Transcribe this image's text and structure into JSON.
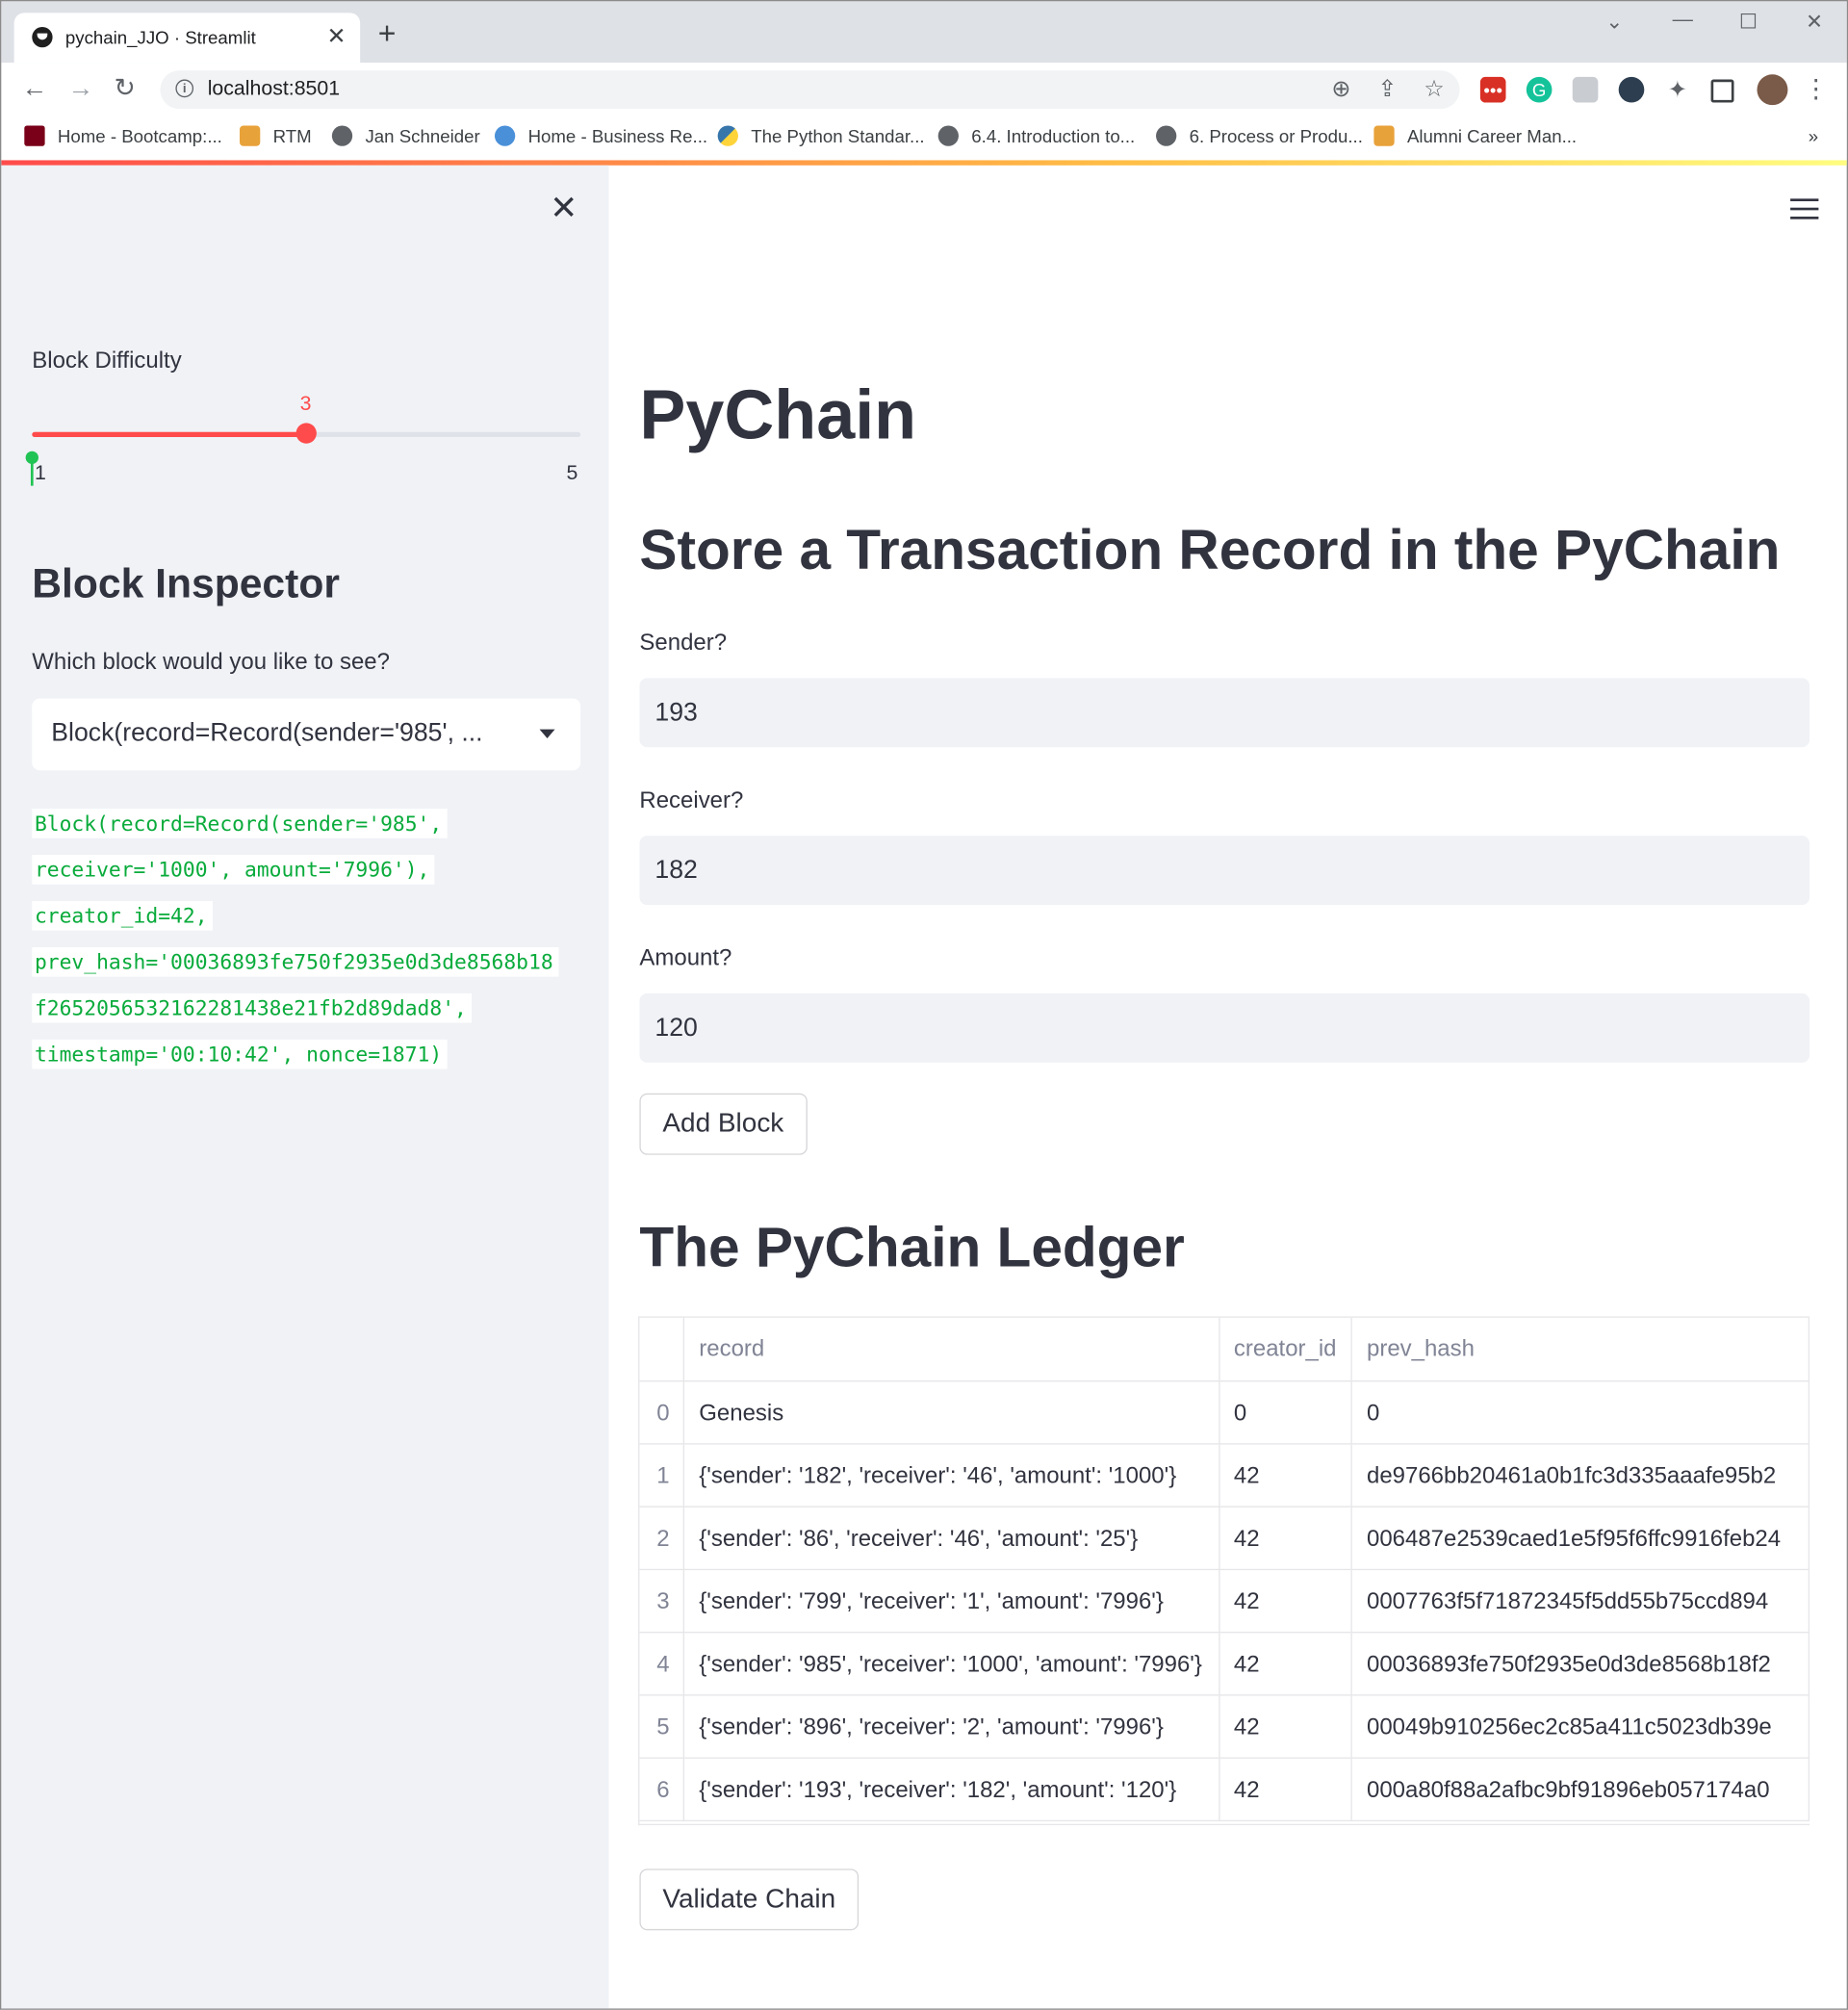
{
  "browser": {
    "tab_title": "pychain_JJO · Streamlit",
    "url": "localhost:8501",
    "bookmarks": [
      "Home - Bootcamp:...",
      "RTM",
      "Jan Schneider",
      "Home - Business Re...",
      "The Python Standar...",
      "6.4. Introduction to...",
      "6. Process or Produ...",
      "Alumni Career Man..."
    ]
  },
  "sidebar": {
    "slider_label": "Block Difficulty",
    "slider_value": "3",
    "slider_min": "1",
    "slider_max": "5",
    "inspector_title": "Block Inspector",
    "select_question": "Which block would you like to see?",
    "select_value": "Block(record=Record(sender='985', ...",
    "code_lines": [
      "Block(record=Record(sender='985',",
      "receiver='1000', amount='7996'),",
      "creator_id=42,",
      "prev_hash='00036893fe750f2935e0d3de8568b18",
      "f2652056532162281438e21fb2d89dad8',",
      "timestamp='00:10:42', nonce=1871)"
    ]
  },
  "main": {
    "title": "PyChain",
    "subtitle": "Store a Transaction Record in the PyChain",
    "sender_label": "Sender?",
    "sender_value": "193",
    "receiver_label": "Receiver?",
    "receiver_value": "182",
    "amount_label": "Amount?",
    "amount_value": "120",
    "add_block_label": "Add Block",
    "ledger_title": "The PyChain Ledger",
    "validate_label": "Validate Chain",
    "ledger": {
      "columns": [
        "",
        "record",
        "creator_id",
        "prev_hash"
      ],
      "rows": [
        [
          "0",
          "Genesis",
          "0",
          "0"
        ],
        [
          "1",
          "{'sender': '182', 'receiver': '46', 'amount': '1000'}",
          "42",
          "de9766bb20461a0b1fc3d335aaafe95b2"
        ],
        [
          "2",
          "{'sender': '86', 'receiver': '46', 'amount': '25'}",
          "42",
          "006487e2539caed1e5f95f6ffc9916feb24"
        ],
        [
          "3",
          "{'sender': '799', 'receiver': '1', 'amount': '7996'}",
          "42",
          "0007763f5f71872345f5dd55b75ccd894"
        ],
        [
          "4",
          "{'sender': '985', 'receiver': '1000', 'amount': '7996'}",
          "42",
          "00036893fe750f2935e0d3de8568b18f2"
        ],
        [
          "5",
          "{'sender': '896', 'receiver': '2', 'amount': '7996'}",
          "42",
          "00049b910256ec2c85a411c5023db39e"
        ],
        [
          "6",
          "{'sender': '193', 'receiver': '182', 'amount': '120'}",
          "42",
          "000a80f88a2afbc9bf91896eb057174a0"
        ]
      ]
    }
  },
  "colors": {
    "accent": "#ff4b4b",
    "sidebar_bg": "#f0f2f6",
    "code_green": "#09ab3b"
  }
}
